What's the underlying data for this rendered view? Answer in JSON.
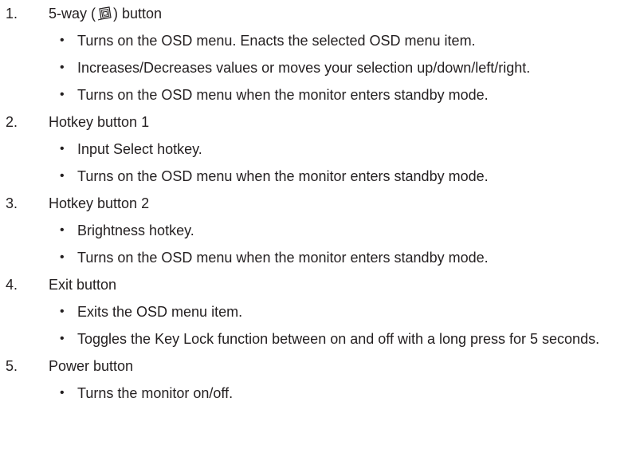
{
  "items": [
    {
      "number": "1.",
      "title_pre": "5-way (",
      "title_icon": "five-way-joystick-icon",
      "title_post": ") button",
      "bullets": [
        "Turns on the OSD menu. Enacts the selected OSD menu item.",
        "Increases/Decreases values or moves your selection up/down/left/right.",
        "Turns on the OSD menu when the monitor enters standby mode."
      ]
    },
    {
      "number": "2.",
      "title": "Hotkey button 1",
      "bullets": [
        "Input Select hotkey.",
        "Turns on the OSD menu when the monitor enters standby mode."
      ]
    },
    {
      "number": "3.",
      "title": "Hotkey button 2",
      "bullets": [
        "Brightness hotkey.",
        "Turns on the OSD menu when the monitor enters standby mode."
      ]
    },
    {
      "number": "4.",
      "title": "Exit button",
      "bullets": [
        "Exits the OSD menu item.",
        "Toggles the Key Lock function between on and off with a long press for 5 seconds."
      ]
    },
    {
      "number": "5.",
      "title": "Power button",
      "bullets": [
        "Turns the monitor on/off."
      ]
    }
  ],
  "bullet_glyph": "•"
}
